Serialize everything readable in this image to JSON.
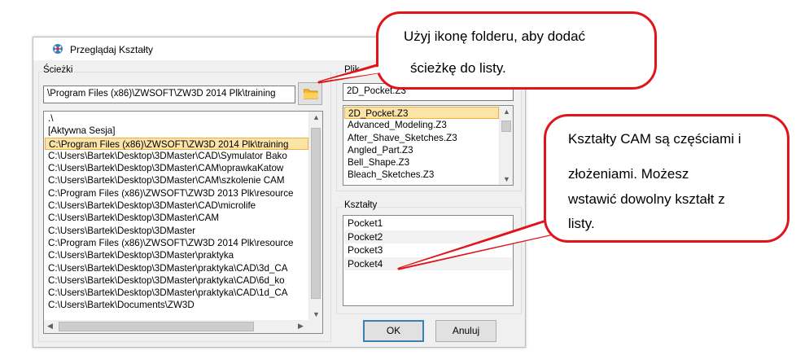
{
  "dialog": {
    "title": "Przeglądaj Kształty",
    "paths_label": "Ścieżki",
    "path_value": "\\Program Files (x86)\\ZWSOFT\\ZW3D 2014 Plk\\training",
    "paths": [
      ".\\",
      "[Aktywna Sesja]",
      "C:\\Program Files (x86)\\ZWSOFT\\ZW3D 2014 Plk\\training",
      "C:\\Users\\Bartek\\Desktop\\3DMaster\\CAD\\Symulator Bako",
      "C:\\Users\\Bartek\\Desktop\\3DMaster\\CAM\\oprawkaKatow",
      "C:\\Users\\Bartek\\Desktop\\3DMaster\\CAM\\szkolenie CAM",
      "C:\\Program Files (x86)\\ZWSOFT\\ZW3D 2013 Plk\\resource",
      "C:\\Users\\Bartek\\Desktop\\3DMaster\\CAD\\microlife",
      "C:\\Users\\Bartek\\Desktop\\3DMaster\\CAM",
      "C:\\Users\\Bartek\\Desktop\\3DMaster",
      "C:\\Program Files (x86)\\ZWSOFT\\ZW3D 2014 Plk\\resource",
      "C:\\Users\\Bartek\\Desktop\\3DMaster\\praktyka",
      "C:\\Users\\Bartek\\Desktop\\3DMaster\\praktyka\\CAD\\3d_CA",
      "C:\\Users\\Bartek\\Desktop\\3DMaster\\praktyka\\CAD\\6d_ko",
      "C:\\Users\\Bartek\\Desktop\\3DMaster\\praktyka\\CAD\\1d_CA",
      "C:\\Users\\Bartek\\Documents\\ZW3D"
    ],
    "file_label": "Plik",
    "file_value": "2D_Pocket.Z3",
    "files": [
      "2D_Pocket.Z3",
      "Advanced_Modeling.Z3",
      "After_Shave_Sketches.Z3",
      "Angled_Part.Z3",
      "Bell_Shape.Z3",
      "Bleach_Sketches.Z3"
    ],
    "shapes_label": "Kształty",
    "shapes": [
      "Pocket1",
      "Pocket2",
      "Pocket3",
      "Pocket4"
    ],
    "ok_label": "OK",
    "cancel_label": "Anuluj"
  },
  "callouts": {
    "folder_line1": "Użyj ikonę folderu, aby dodać",
    "folder_line2": "ścieżkę do listy.",
    "shapes_line1": "Kształty CAM są częściami i",
    "shapes_line2": "złożeniami. Możesz",
    "shapes_line3": "wstawić dowolny kształt z",
    "shapes_line4": "listy."
  },
  "colors": {
    "callout_border": "#e0141a",
    "selection": "#fce4a8",
    "folder": "#f5b82e"
  }
}
